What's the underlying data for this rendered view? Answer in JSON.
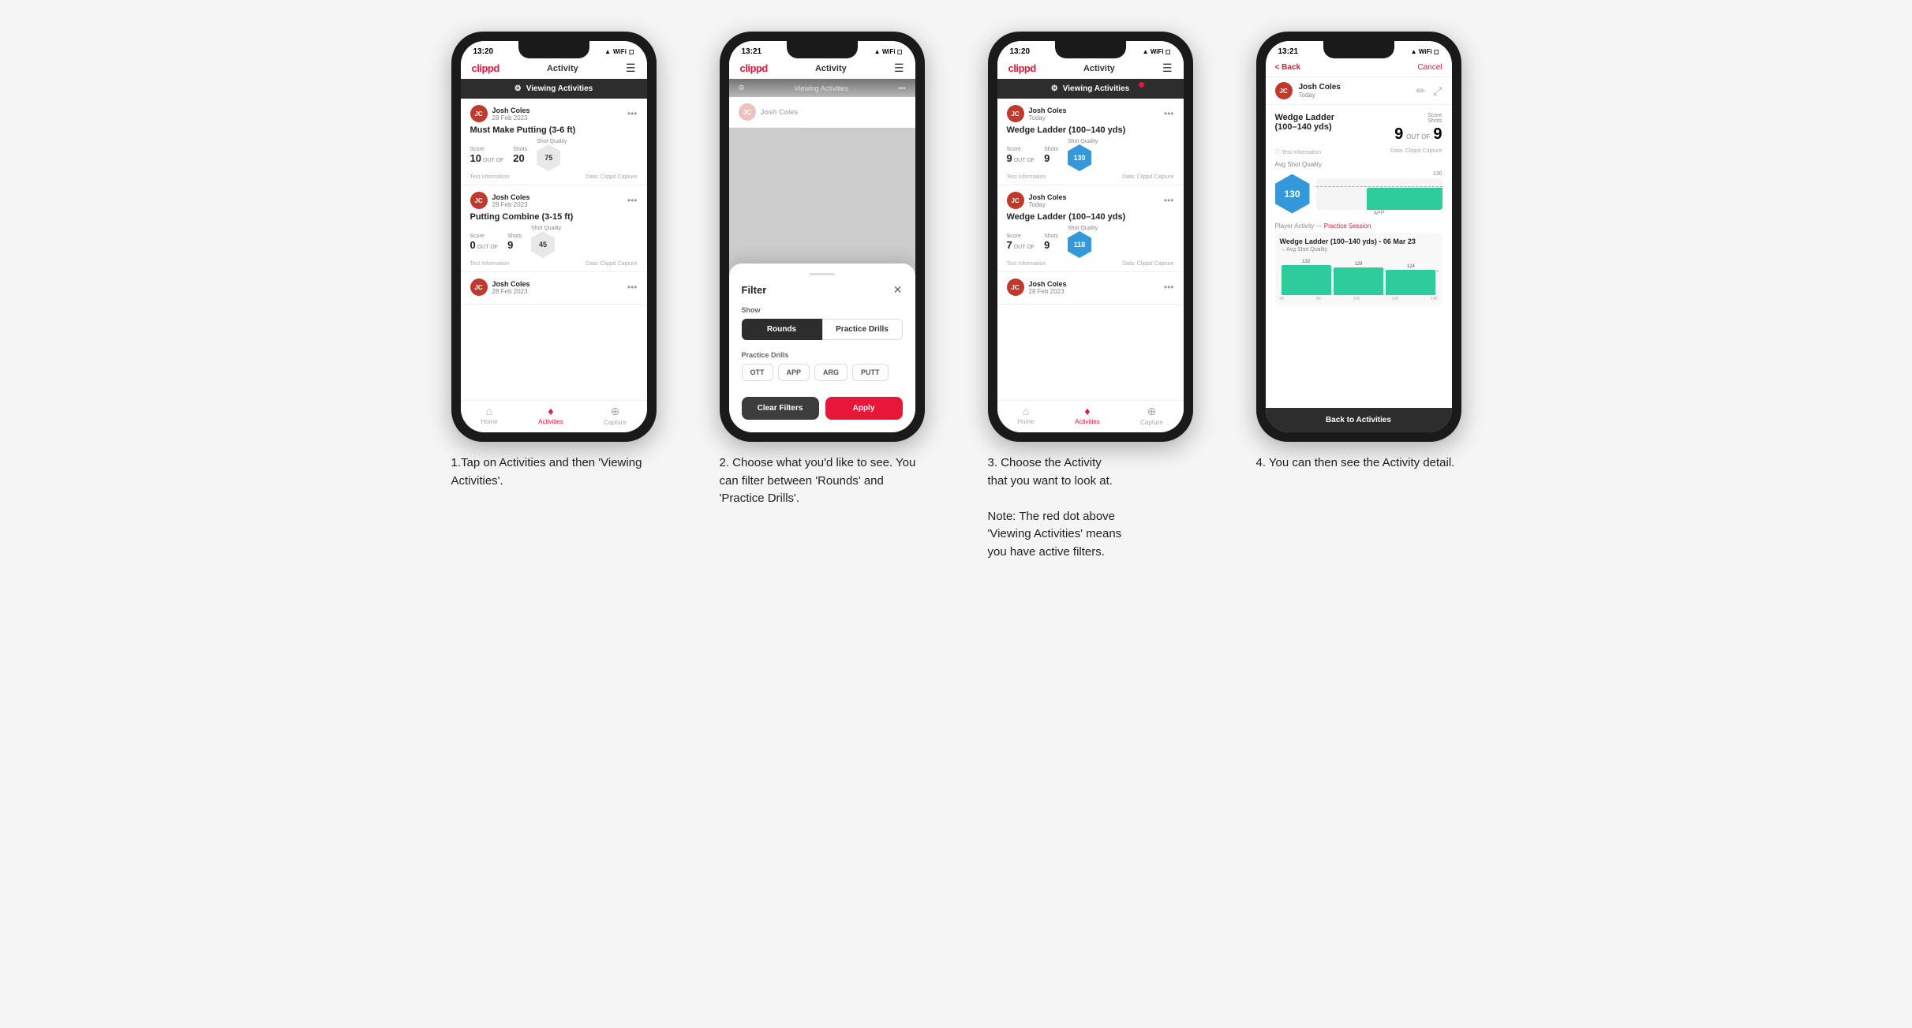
{
  "steps": [
    {
      "id": "step1",
      "phone": {
        "statusBar": {
          "time": "13:20",
          "icons": "▲ ◈ ◻"
        },
        "navLogo": "clippd",
        "navTitle": "Activity",
        "viewingActivities": "Viewing Activities",
        "hasRedDot": false,
        "cards": [
          {
            "userName": "Josh Coles",
            "userDate": "28 Feb 2023",
            "title": "Must Make Putting (3-6 ft)",
            "scoreLabel": "Score",
            "shotLabel": "Shots",
            "qualityLabel": "Shot Quality",
            "score": "10",
            "outOf": "OUT OF",
            "shots": "20",
            "quality": "75",
            "qualityBlue": false,
            "testInfo": "Test Information",
            "dataSource": "Data: Clippd Capture"
          },
          {
            "userName": "Josh Coles",
            "userDate": "28 Feb 2023",
            "title": "Putting Combine (3-15 ft)",
            "scoreLabel": "Score",
            "shotLabel": "Shots",
            "qualityLabel": "Shot Quality",
            "score": "0",
            "outOf": "OUT OF",
            "shots": "9",
            "quality": "45",
            "qualityBlue": false,
            "testInfo": "Test Information",
            "dataSource": "Data: Clippd Capture"
          },
          {
            "userName": "Josh Coles",
            "userDate": "28 Feb 2023",
            "title": "",
            "partial": true
          }
        ]
      },
      "tabs": [
        {
          "label": "Home",
          "icon": "⌂",
          "active": false
        },
        {
          "label": "Activities",
          "icon": "♦",
          "active": true
        },
        {
          "label": "Capture",
          "icon": "⊕",
          "active": false
        }
      ],
      "caption": "1.Tap on Activities and then 'Viewing Activities'."
    },
    {
      "id": "step2",
      "phone": {
        "statusBar": {
          "time": "13:21",
          "icons": "▲ ◈ ◻"
        },
        "navLogo": "clippd",
        "navTitle": "Activity",
        "viewingActivities": "Viewing Activities",
        "hasRedDot": true,
        "filter": {
          "title": "Filter",
          "showLabel": "Show",
          "rounds": "Rounds",
          "practicedrills": "Practice Drills",
          "practiceDrillsLabel": "Practice Drills",
          "drills": [
            "OTT",
            "APP",
            "ARG",
            "PUTT"
          ],
          "clearFilters": "Clear Filters",
          "apply": "Apply"
        }
      },
      "caption": "2. Choose what you'd like to see. You can filter between 'Rounds' and 'Practice Drills'."
    },
    {
      "id": "step3",
      "phone": {
        "statusBar": {
          "time": "13:20",
          "icons": "▲ ◈ ◻"
        },
        "navLogo": "clippd",
        "navTitle": "Activity",
        "viewingActivities": "Viewing Activities",
        "hasRedDot": true,
        "cards": [
          {
            "userName": "Josh Coles",
            "userDate": "Today",
            "title": "Wedge Ladder (100–140 yds)",
            "score": "9",
            "outOf": "OUT OF",
            "shots": "9",
            "quality": "130",
            "qualityBlue": true,
            "testInfo": "Test Information",
            "dataSource": "Data: Clippd Capture"
          },
          {
            "userName": "Josh Coles",
            "userDate": "Today",
            "title": "Wedge Ladder (100–140 yds)",
            "score": "7",
            "outOf": "OUT OF",
            "shots": "9",
            "quality": "118",
            "qualityBlue": true,
            "testInfo": "Test Information",
            "dataSource": "Data: Clippd Capture"
          },
          {
            "userName": "Josh Coles",
            "userDate": "28 Feb 2023",
            "title": "",
            "partial": true
          }
        ]
      },
      "tabs": [
        {
          "label": "Home",
          "icon": "⌂",
          "active": false
        },
        {
          "label": "Activities",
          "icon": "♦",
          "active": true
        },
        {
          "label": "Capture",
          "icon": "⊕",
          "active": false
        }
      ],
      "caption": "3. Choose the Activity that you want to look at.\n\nNote: The red dot above 'Viewing Activities' means you have active filters."
    },
    {
      "id": "step4",
      "phone": {
        "statusBar": {
          "time": "13:21",
          "icons": "▲ ◈ ◻"
        },
        "back": "< Back",
        "cancel": "Cancel",
        "userName": "Josh Coles",
        "userDate": "Today",
        "activityTitle": "Wedge Ladder\n(100–140 yds)",
        "scoreLabel": "Score",
        "shotsLabel": "Shots",
        "scoreVal": "9",
        "outOf": "OUT OF",
        "shotsVal": "9",
        "qualityVal": "130",
        "testInfo": "Test Information",
        "dataCapture": "Data: Clippd Capture",
        "avgShotQuality": "Avg Shot Quality",
        "chartBars": [
          {
            "value": 132,
            "heightPct": 85
          },
          {
            "value": 129,
            "heightPct": 82
          },
          {
            "value": 124,
            "heightPct": 78
          }
        ],
        "chartLabels": [
          "132",
          "129",
          "124"
        ],
        "appLabel": "APP",
        "playerActivityLabel": "Player Activity",
        "practiceSession": "Practice Session",
        "practiceDetailTitle": "Wedge Ladder (100–140 yds) - 06 Mar 23",
        "practiceDetailSub": "Avg Shot Quality",
        "backToActivities": "Back to Activities"
      },
      "caption": "4. You can then see the Activity detail."
    }
  ]
}
